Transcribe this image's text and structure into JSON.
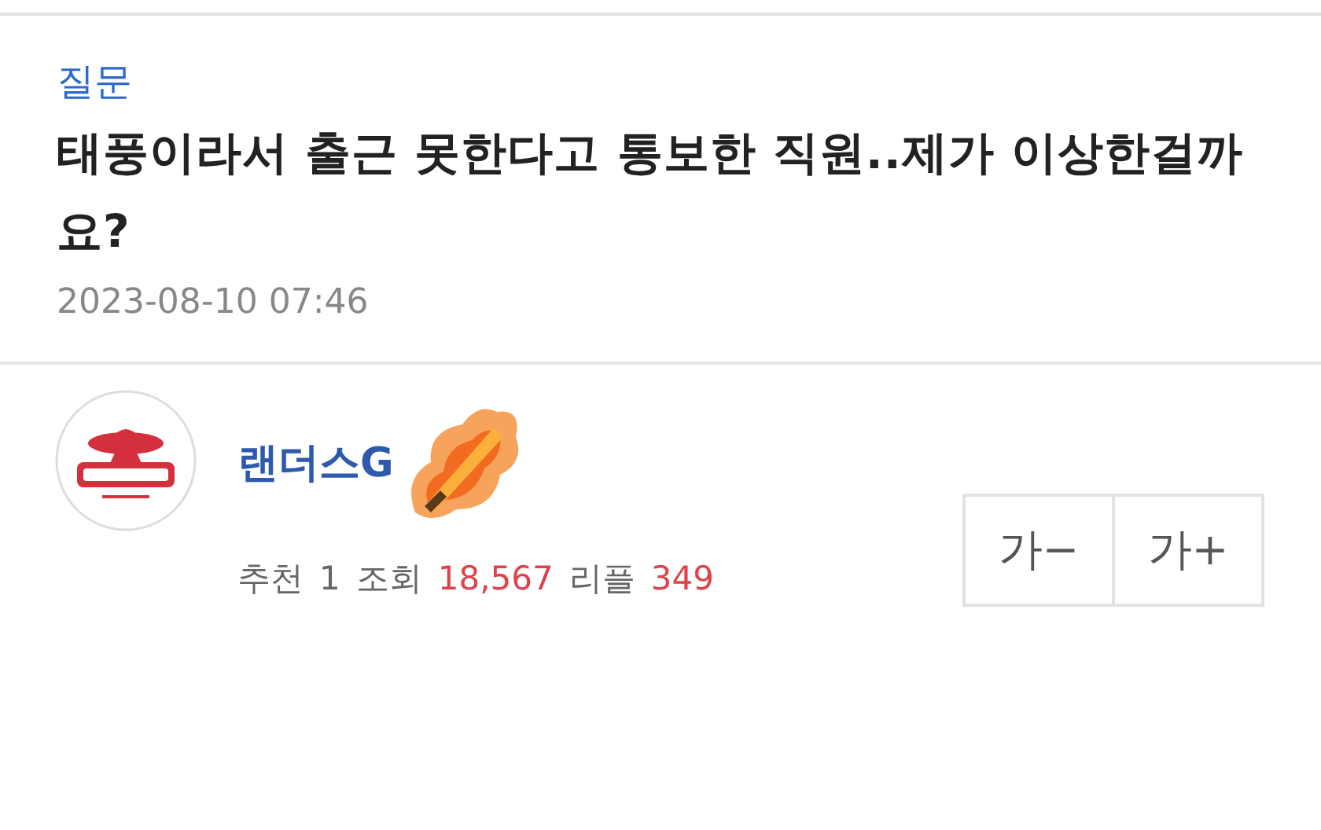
{
  "post": {
    "category": "질문",
    "title": "태풍이라서 출근 못한다고 통보한 직원..제가 이상한걸까요?",
    "date": "2023-08-10 07:46"
  },
  "author": {
    "nickname": "랜더스G"
  },
  "stats": [
    {
      "label": "추천",
      "value": "1",
      "kind": "plain"
    },
    {
      "label": "조회",
      "value": "18,567",
      "kind": "accent"
    },
    {
      "label": "리플",
      "value": "349",
      "kind": "accent"
    }
  ],
  "font_buttons": [
    "가−",
    "가+"
  ]
}
